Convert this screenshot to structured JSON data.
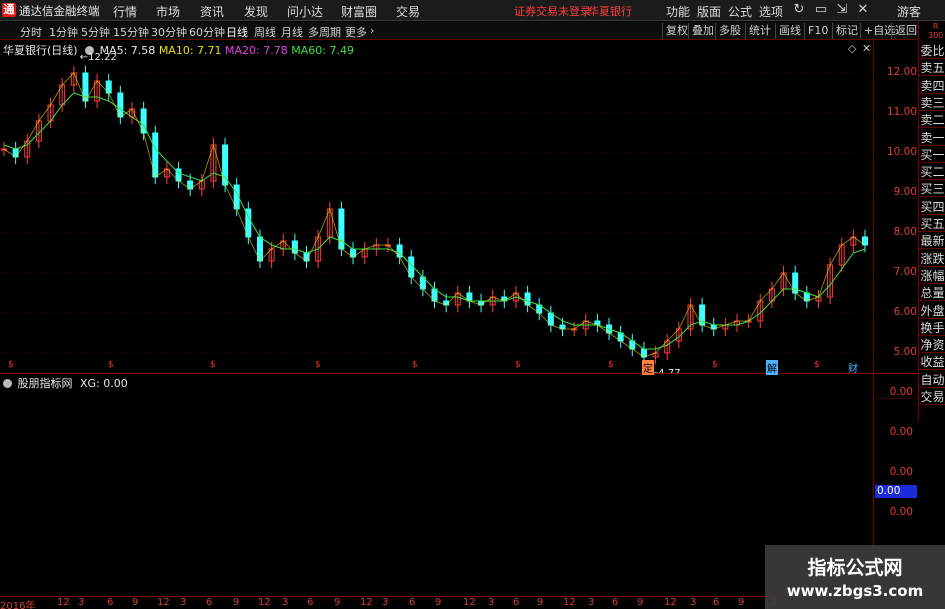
{
  "menubar": {
    "logo": "通",
    "app_title": "通达信金融终端",
    "items": [
      "行情",
      "市场",
      "资讯",
      "发现",
      "问小达",
      "财富圈",
      "交易"
    ],
    "warning": "证券交易未登录",
    "stock_name": "华夏银行",
    "right_items": [
      "功能",
      "版面",
      "公式",
      "选项"
    ],
    "guest": "游客"
  },
  "toolbar": {
    "periods": [
      "分时",
      "1分钟",
      "5分钟",
      "15分钟",
      "30分钟",
      "60分钟",
      "日线",
      "周线",
      "月线",
      "多周期",
      "更多"
    ],
    "active": "日线",
    "right_buttons": [
      "复权",
      "叠加",
      "多股",
      "统计",
      "画线",
      "F10",
      "标记",
      "+自选",
      "返回"
    ]
  },
  "main_chart": {
    "title": "华夏银行(日线)",
    "ma5": "MA5: 7.58",
    "ma10": "MA10: 7.71",
    "ma20": "MA20: 7.78",
    "ma60": "MA60: 7.49",
    "high_label": "12.22",
    "low_label": "4.77",
    "price_ticks": [
      "12.00",
      "11.00",
      "10.00",
      "9.00",
      "8.00",
      "7.00",
      "6.00",
      "5.00"
    ],
    "events": [
      "定",
      "解",
      "财"
    ]
  },
  "indicator": {
    "title": "股朋指标网",
    "value": "XG: 0.00",
    "ticks": [
      "0.00",
      "0.00",
      "0.00",
      "0.00",
      "0.00"
    ],
    "current": "0.00"
  },
  "side_panel": {
    "items": [
      "委比",
      "卖五",
      "卖四",
      "卖三",
      "卖二",
      "卖一",
      "买一",
      "买二",
      "买三",
      "买四",
      "买五",
      "最新",
      "涨跌",
      "涨幅",
      "总量",
      "外盘",
      "换手",
      "净资",
      "收益",
      "自动",
      "交易"
    ]
  },
  "time_axis": {
    "labels": [
      "2016年",
      "12",
      "3",
      "6",
      "9",
      "12",
      "3",
      "6",
      "9",
      "12",
      "3",
      "6",
      "9",
      "12",
      "3",
      "6",
      "9",
      "12",
      "3",
      "6",
      "9",
      "12",
      "3",
      "6",
      "9",
      "12",
      "3",
      "6",
      "9",
      "12"
    ]
  },
  "watermark": {
    "line1": "指标公式网",
    "line2": "www.zbgs3.com"
  },
  "chart_data": {
    "type": "line",
    "title": "华夏银行(日线)",
    "ylim": [
      4.5,
      12.8
    ],
    "y_ticks": [
      5,
      6,
      7,
      8,
      9,
      10,
      11,
      12
    ],
    "close": [
      10.1,
      9.9,
      10.3,
      10.8,
      11.2,
      11.7,
      12.0,
      11.3,
      11.8,
      11.5,
      10.9,
      11.1,
      10.5,
      9.4,
      9.6,
      9.3,
      9.1,
      9.3,
      10.2,
      9.2,
      8.6,
      7.9,
      7.3,
      7.6,
      7.8,
      7.5,
      7.3,
      7.9,
      8.6,
      7.6,
      7.4,
      7.6,
      7.7,
      7.7,
      7.4,
      6.9,
      6.6,
      6.3,
      6.2,
      6.5,
      6.3,
      6.2,
      6.4,
      6.3,
      6.5,
      6.2,
      6.0,
      5.7,
      5.6,
      5.6,
      5.8,
      5.7,
      5.5,
      5.3,
      5.1,
      4.9,
      5.0,
      5.3,
      5.6,
      6.2,
      5.7,
      5.6,
      5.7,
      5.8,
      5.8,
      6.3,
      6.6,
      7.0,
      6.5,
      6.3,
      6.4,
      7.2,
      7.7,
      7.9,
      7.7
    ],
    "ma": [
      10.2,
      10.1,
      10.2,
      10.5,
      10.8,
      11.2,
      11.5,
      11.4,
      11.4,
      11.3,
      11.1,
      10.9,
      10.7,
      10.1,
      9.8,
      9.5,
      9.4,
      9.3,
      9.5,
      9.4,
      9.0,
      8.4,
      7.9,
      7.7,
      7.6,
      7.6,
      7.5,
      7.6,
      7.9,
      7.8,
      7.6,
      7.6,
      7.6,
      7.6,
      7.5,
      7.2,
      6.9,
      6.6,
      6.4,
      6.4,
      6.3,
      6.3,
      6.3,
      6.3,
      6.4,
      6.3,
      6.2,
      6.0,
      5.8,
      5.7,
      5.7,
      5.7,
      5.6,
      5.5,
      5.3,
      5.1,
      5.1,
      5.2,
      5.4,
      5.7,
      5.8,
      5.7,
      5.7,
      5.7,
      5.8,
      6.0,
      6.3,
      6.6,
      6.6,
      6.5,
      6.4,
      6.7,
      7.1,
      7.5,
      7.6
    ],
    "high_marker": 12.22,
    "low_marker": 4.77
  }
}
